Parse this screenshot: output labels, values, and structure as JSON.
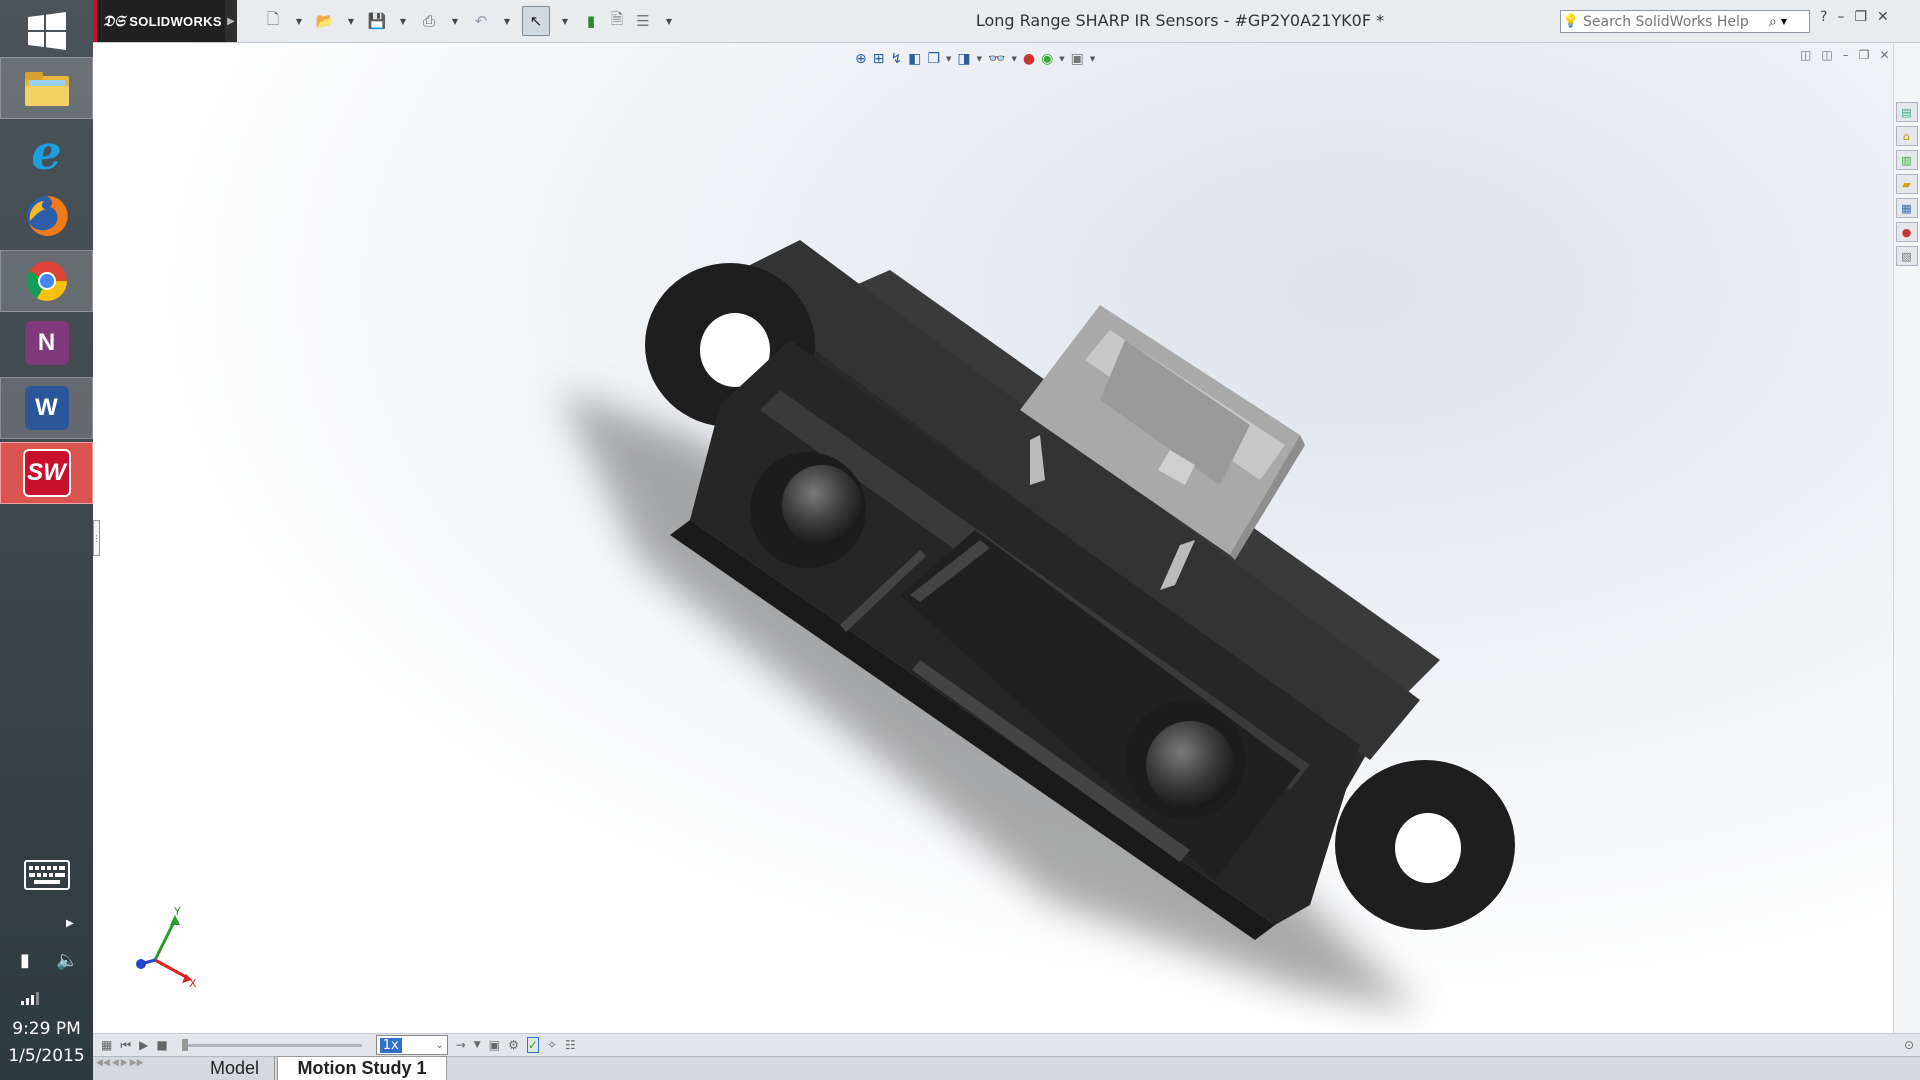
{
  "app": {
    "name": "SOLIDWORKS",
    "document_title": "Long Range SHARP IR Sensors - #GP2Y0A21YK0F *"
  },
  "search": {
    "placeholder": "Search SolidWorks Help"
  },
  "taskbar": {
    "apps": [
      {
        "name": "windows-start",
        "label": "Start"
      },
      {
        "name": "file-explorer",
        "label": "File Explorer"
      },
      {
        "name": "internet-explorer",
        "label": "e"
      },
      {
        "name": "firefox",
        "label": "Firefox"
      },
      {
        "name": "chrome",
        "label": "Chrome"
      },
      {
        "name": "onenote",
        "label": "N"
      },
      {
        "name": "word",
        "label": "W"
      },
      {
        "name": "solidworks",
        "label": "SW"
      }
    ],
    "clock_time": "9:29 PM",
    "clock_date": "1/5/2015"
  },
  "motion_study": {
    "speed": "1x"
  },
  "tabs": {
    "model": "Model",
    "motion_study_1": "Motion Study 1"
  },
  "triad": {
    "x": "X",
    "y": "Y"
  },
  "colors": {
    "sensor_body": "#262626",
    "connector": "#a9a9a9",
    "brand_red": "#c8102e",
    "selection_blue": "#3071c9"
  }
}
